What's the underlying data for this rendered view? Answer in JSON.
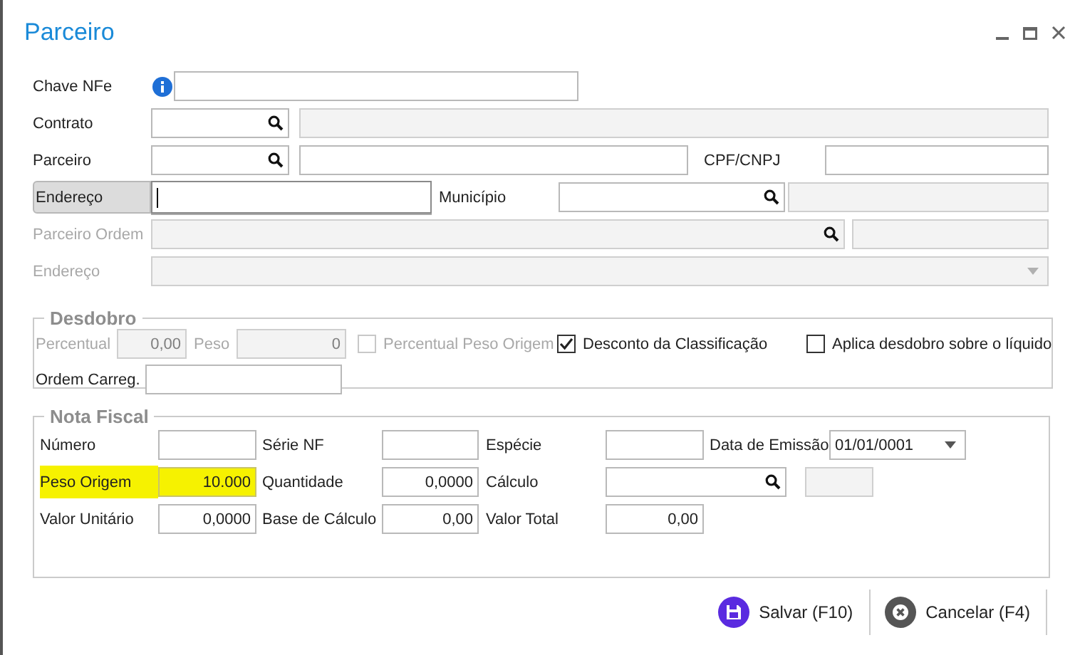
{
  "window": {
    "title": "Parceiro"
  },
  "main_rows": [
    {
      "focused": false,
      "items": [
        {
          "kind": "label",
          "text": "Chave NFe",
          "disabled": false
        },
        {
          "kind": "info"
        },
        {
          "kind": "text",
          "disabled": false
        }
      ]
    },
    {
      "focused": false,
      "items": [
        {
          "kind": "label",
          "text": "Contrato",
          "disabled": false
        },
        {
          "kind": "search",
          "disabled": false
        },
        {
          "kind": "text",
          "disabled": true
        }
      ]
    },
    {
      "focused": false,
      "items": [
        {
          "kind": "label",
          "text": "Parceiro",
          "disabled": false
        },
        {
          "kind": "search",
          "disabled": false
        },
        {
          "kind": "text",
          "disabled": false
        },
        {
          "kind": "label",
          "text": "CPF/CNPJ",
          "disabled": false
        },
        {
          "kind": "text",
          "disabled": false
        }
      ]
    },
    {
      "focused": true,
      "items": [
        {
          "kind": "label",
          "text": "Endereço",
          "disabled": false
        },
        {
          "kind": "text",
          "disabled": false
        },
        {
          "kind": "label",
          "text": "Município",
          "disabled": false
        },
        {
          "kind": "search",
          "disabled": false
        },
        {
          "kind": "text",
          "disabled": true
        }
      ]
    },
    {
      "focused": false,
      "items": [
        {
          "kind": "label",
          "text": "Parceiro Ordem",
          "disabled": true
        },
        {
          "kind": "search",
          "disabled": true
        },
        {
          "kind": "text",
          "disabled": true
        }
      ]
    },
    {
      "focused": false,
      "items": [
        {
          "kind": "label",
          "text": "Endereço",
          "disabled": true
        },
        {
          "kind": "combo",
          "disabled": true
        }
      ]
    }
  ],
  "desdobro": {
    "title": "Desdobro",
    "rows": [
      [
        {
          "kind": "label",
          "text": "Percentual",
          "disabled": true
        },
        {
          "kind": "text",
          "value": "0,00",
          "disabled": true
        },
        {
          "kind": "label",
          "text": "Peso",
          "disabled": true
        },
        {
          "kind": "text",
          "value": "0",
          "disabled": true
        },
        {
          "kind": "checkbox",
          "text": "Percentual Peso Origem",
          "checked": false,
          "disabled": true
        },
        {
          "kind": "checkbox",
          "text": "Desconto da Classificação",
          "checked": true,
          "disabled": false
        },
        {
          "kind": "checkbox",
          "text": "Aplica desdobro sobre o líquido",
          "checked": false,
          "disabled": false
        }
      ],
      [
        {
          "kind": "label",
          "text": "Ordem Carreg.",
          "disabled": false
        },
        {
          "kind": "text",
          "disabled": false
        }
      ]
    ]
  },
  "nota_fiscal": {
    "title": "Nota Fiscal",
    "rows": [
      [
        {
          "kind": "label",
          "text": "Número",
          "highlighted": false
        },
        {
          "kind": "text",
          "highlighted": false,
          "disabled": false
        },
        {
          "kind": "label",
          "text": "Série NF",
          "highlighted": false
        },
        {
          "kind": "text",
          "highlighted": false,
          "disabled": false
        },
        {
          "kind": "label",
          "text": "Espécie",
          "highlighted": false
        },
        {
          "kind": "text",
          "highlighted": false,
          "disabled": false
        },
        {
          "kind": "label",
          "text": "Data de Emissão",
          "highlighted": false
        },
        {
          "kind": "combo",
          "value": "01/01/0001",
          "highlighted": false,
          "disabled": false
        }
      ],
      [
        {
          "kind": "label",
          "text": "Peso Origem",
          "highlighted": true
        },
        {
          "kind": "text",
          "value": "10.000",
          "highlighted": true,
          "disabled": false
        },
        {
          "kind": "label",
          "text": "Quantidade",
          "highlighted": false
        },
        {
          "kind": "text",
          "value": "0,0000",
          "highlighted": false,
          "disabled": false
        },
        {
          "kind": "label",
          "text": "Cálculo",
          "highlighted": false
        },
        {
          "kind": "search",
          "highlighted": false,
          "disabled": false
        },
        {
          "kind": "text",
          "highlighted": false,
          "disabled": true
        }
      ],
      [
        {
          "kind": "label",
          "text": "Valor Unitário",
          "highlighted": false
        },
        {
          "kind": "text",
          "value": "0,0000",
          "highlighted": false,
          "disabled": false
        },
        {
          "kind": "label",
          "text": "Base de Cálculo",
          "highlighted": false
        },
        {
          "kind": "text",
          "value": "0,00",
          "highlighted": false,
          "disabled": false
        },
        {
          "kind": "label",
          "text": "Valor Total",
          "highlighted": false
        },
        {
          "kind": "text",
          "value": "0,00",
          "highlighted": false,
          "disabled": false
        }
      ]
    ]
  },
  "buttons": [
    {
      "kind": "save",
      "label": "Salvar (F10)"
    },
    {
      "kind": "cancel",
      "label": "Cancelar (F4)"
    }
  ]
}
